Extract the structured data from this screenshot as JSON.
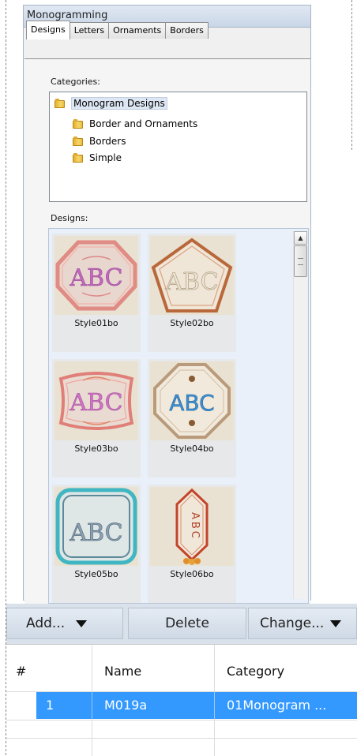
{
  "panel": {
    "title": "Monogramming",
    "tabs": [
      "Designs",
      "Letters",
      "Ornaments",
      "Borders"
    ],
    "categories_label": "Categories:",
    "categories": [
      "Monogram Designs",
      "Border and Ornaments",
      "Borders",
      "Simple"
    ],
    "designs_label": "Designs:",
    "designs": [
      {
        "name": "Style01bo",
        "letters": "ABC",
        "color": "#b45fb0"
      },
      {
        "name": "Style02bo",
        "letters": "ABC",
        "color": "#e4d9c4"
      },
      {
        "name": "Style03bo",
        "letters": "ABC",
        "color": "#c460b4"
      },
      {
        "name": "Style04bo",
        "letters": "ABC",
        "color": "#3d8fd0"
      },
      {
        "name": "Style05bo",
        "letters": "ABC",
        "color": "#7f96a8"
      },
      {
        "name": "Style06bo",
        "letters": "ABC",
        "color": "#c3442a"
      }
    ]
  },
  "toolbar": {
    "add_label": "Add...",
    "delete_label": "Delete",
    "change_label": "Change..."
  },
  "list": {
    "headers": [
      "#",
      "Name",
      "Category"
    ],
    "rows": [
      {
        "num": "1",
        "name": "M019a",
        "category": "01Monogram ..."
      }
    ]
  }
}
